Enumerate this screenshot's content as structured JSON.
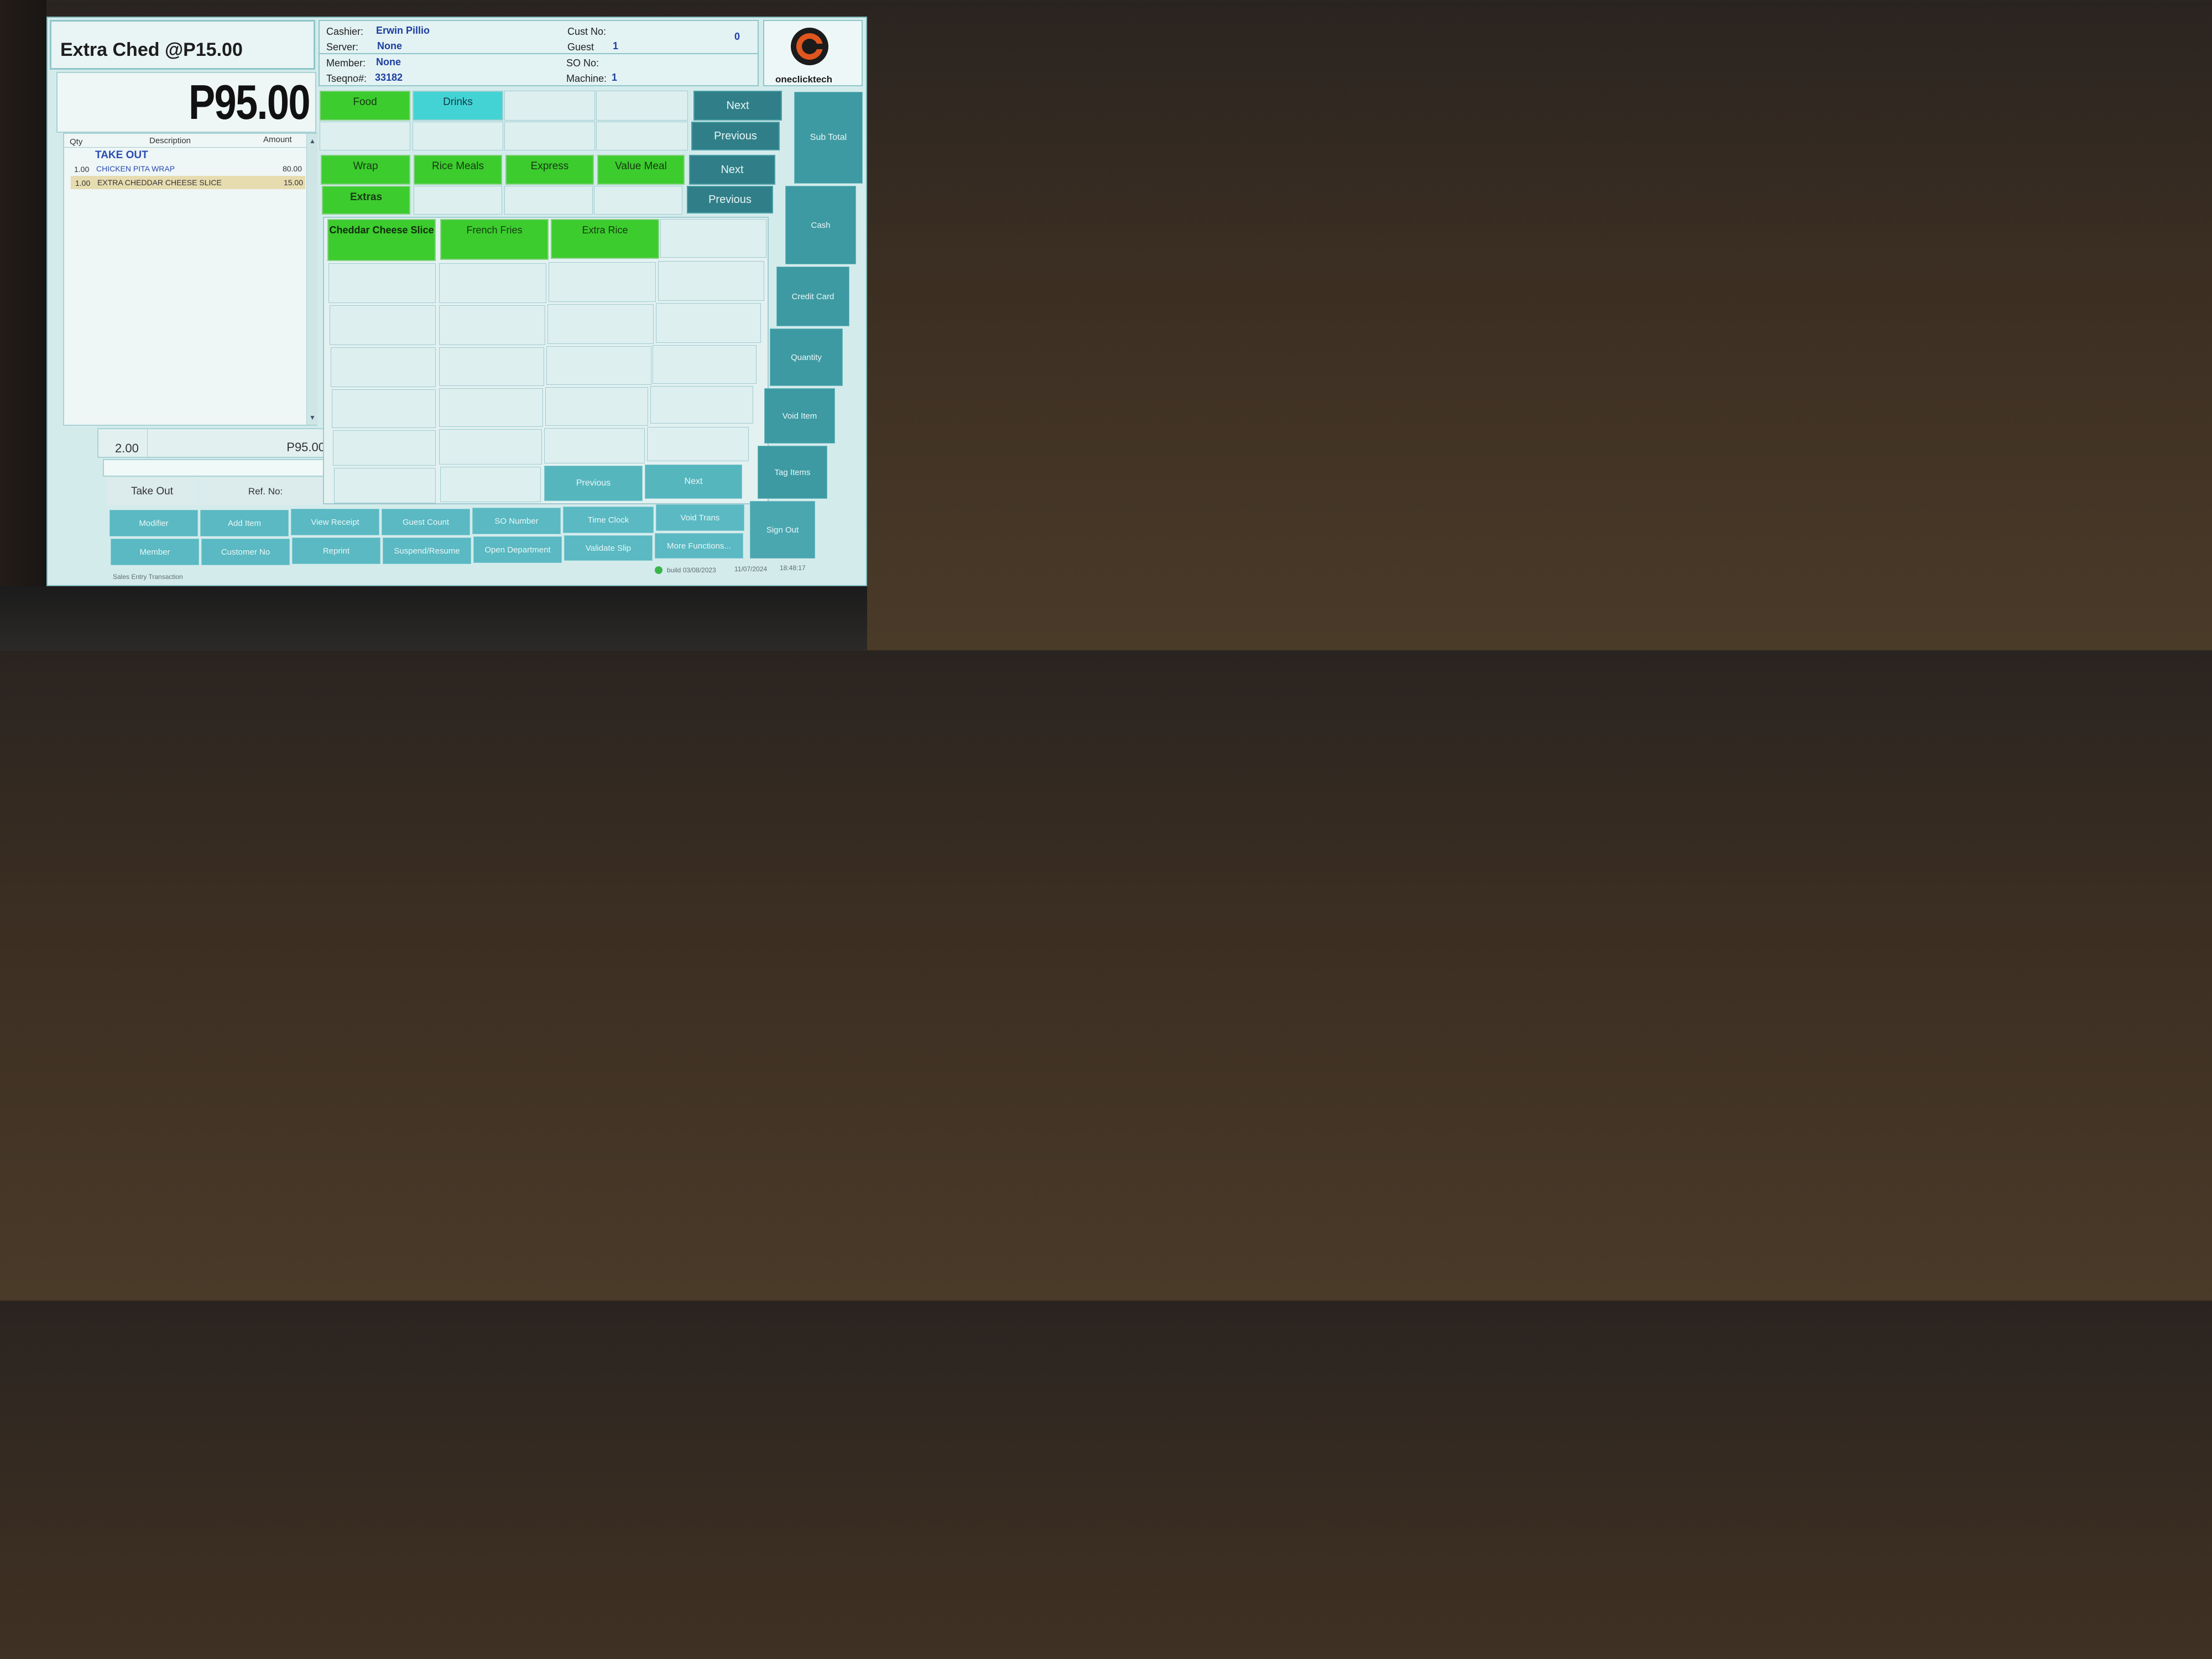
{
  "header": {
    "title": "Extra Ched @P15.00",
    "cashier_label": "Cashier:",
    "cashier": "Erwin Pillio",
    "server_label": "Server:",
    "server": "None",
    "member_label": "Member:",
    "member": "None",
    "tseqno_label": "Tseqno#:",
    "tseqno": "33182",
    "custno_label": "Cust No:",
    "custno": "0",
    "guest_label": "Guest",
    "guest": "1",
    "sono_label": "SO No:",
    "machine_label": "Machine:",
    "machine": "1",
    "logo_text": "oneclicktech"
  },
  "total": {
    "display": "P95.00"
  },
  "order": {
    "col_qty": "Qty",
    "col_desc": "Description",
    "col_amount": "Amount",
    "section": "TAKE OUT",
    "items": [
      {
        "qty": "1.00",
        "desc": "CHICKEN PITA WRAP",
        "amount": "80.00"
      },
      {
        "qty": "1.00",
        "desc": "EXTRA CHEDDAR CHEESE SLICE",
        "amount": "15.00"
      }
    ],
    "sum_qty": "2.00",
    "sum_amount": "P95.00",
    "take_out": "Take Out",
    "ref_no": "Ref. No:"
  },
  "categories": {
    "food": "Food",
    "drinks": "Drinks",
    "next": "Next",
    "previous": "Previous"
  },
  "subcategories": {
    "wrap": "Wrap",
    "rice_meals": "Rice Meals",
    "express": "Express",
    "value_meal": "Value Meal",
    "extras": "Extras",
    "next": "Next",
    "previous": "Previous"
  },
  "items": {
    "cheddar": "Cheddar Cheese Slice",
    "fries": "French Fries",
    "rice": "Extra Rice",
    "previous": "Previous",
    "next": "Next"
  },
  "side": {
    "sub_total": "Sub Total",
    "cash": "Cash",
    "credit_card": "Credit Card",
    "quantity": "Quantity",
    "void_item": "Void Item",
    "tag_items": "Tag Items",
    "sign_out": "Sign Out"
  },
  "functions": {
    "modifier": "Modifier",
    "add_item": "Add Item",
    "view_receipt": "View Receipt",
    "guest_count": "Guest Count",
    "so_number": "SO Number",
    "time_clock": "Time Clock",
    "void_trans": "Void Trans",
    "member": "Member",
    "customer_no": "Customer No",
    "reprint": "Reprint",
    "suspend": "Suspend/Resume",
    "open_dept": "Open Department",
    "validate": "Validate Slip",
    "more": "More Functions..."
  },
  "status": {
    "left": "Sales Entry Transaction",
    "build": "build 03/08/2023",
    "date": "11/07/2024",
    "time": "18:48:17"
  },
  "colors": {
    "green": "#3ccc2e",
    "cyan": "#44d3d4",
    "teal": "#307f88",
    "accent_text": "#1c3ea0"
  }
}
